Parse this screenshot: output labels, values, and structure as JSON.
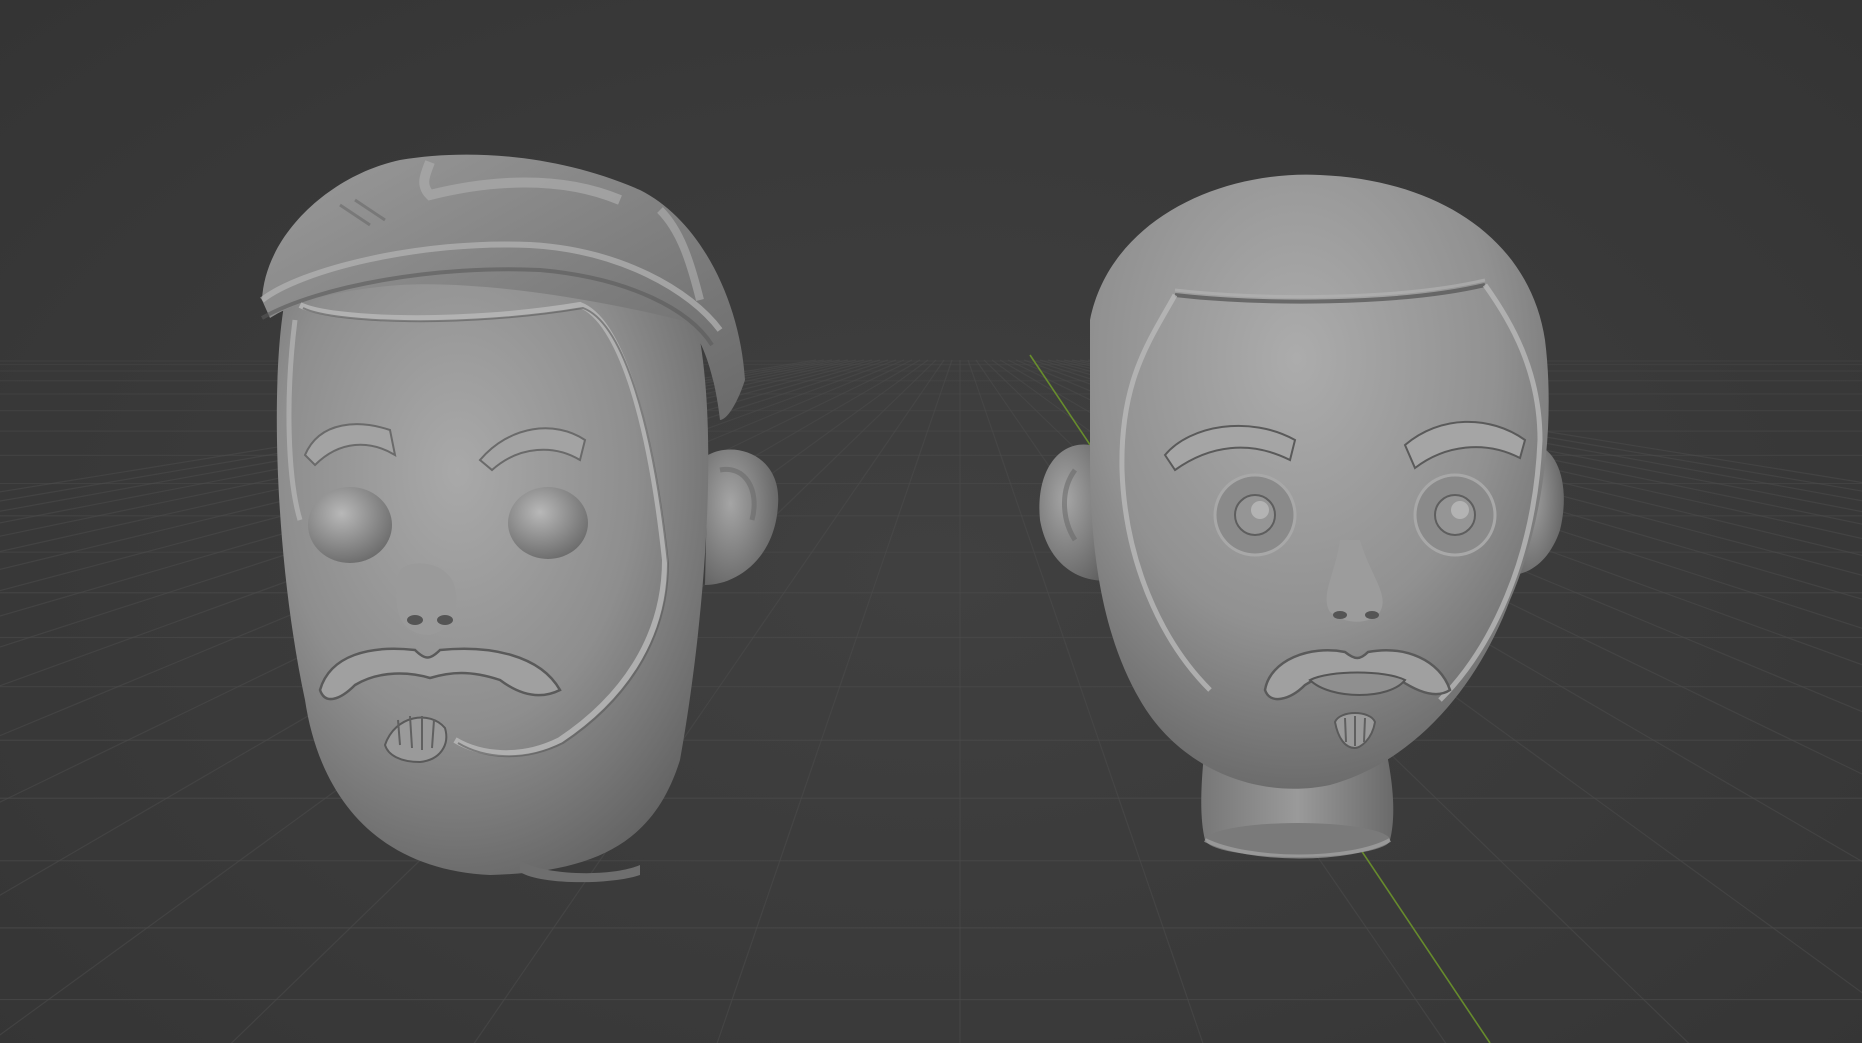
{
  "app": {
    "kind": "3d-viewport",
    "shading": "solid"
  },
  "colors": {
    "background": "#393939",
    "grid_line": "#4a4a4a",
    "y_axis": "#6f9a2a",
    "clay": "#8f8f8f",
    "clay_highlight": "#b3b3b3",
    "clay_shadow": "#5c5c5c"
  },
  "objects": [
    {
      "name": "head-with-cap",
      "icon": "sculpt-mesh",
      "features": [
        "backwards-cap",
        "mustache",
        "goatee",
        "beard-line",
        "eyebrows",
        "eyes",
        "ear"
      ]
    },
    {
      "name": "head-with-neck",
      "icon": "sculpt-mesh",
      "features": [
        "bald-crown",
        "hairline",
        "eyes-with-pupils",
        "mustache",
        "goatee",
        "beard-line",
        "ears",
        "neck-stand"
      ]
    }
  ],
  "grid": {
    "visible": true,
    "floor": true
  },
  "axes": {
    "y_visible": true,
    "x_visible": false
  }
}
